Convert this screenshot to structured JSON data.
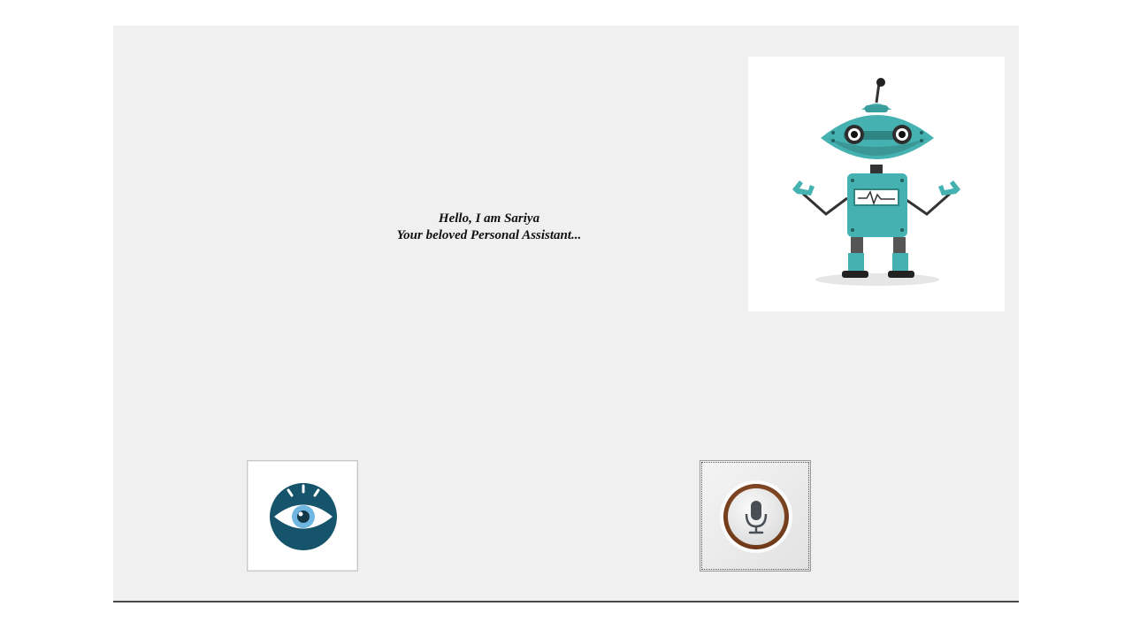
{
  "greeting": {
    "line1": "Hello, I am Sariya",
    "line2": "Your beloved Personal Assistant..."
  },
  "images": {
    "robot": "robot-mascot",
    "eye_button_icon": "eye-icon",
    "mic_button_icon": "microphone-icon"
  },
  "colors": {
    "window_bg": "#f0f0f0",
    "robot_teal": "#45b2b1",
    "eye_circle": "#16546b",
    "mic_ring": "#8b4a22"
  }
}
